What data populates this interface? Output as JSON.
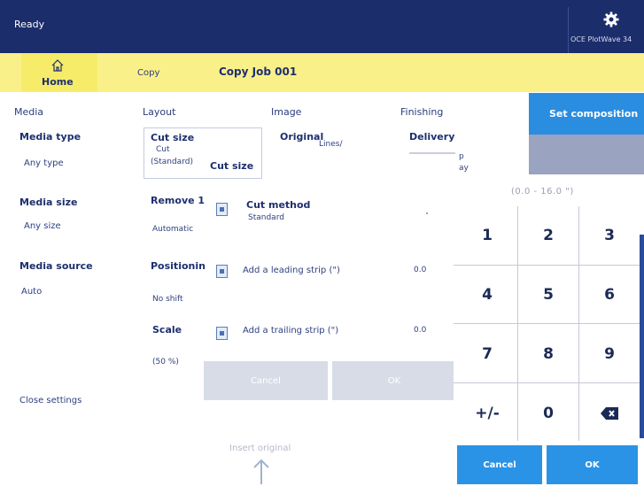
{
  "topbar": {
    "status": "Ready",
    "printer_name": "OCE PlotWave 34",
    "gear_icon": "gear-icon"
  },
  "nav": {
    "home": "Home",
    "copy": "Copy",
    "job": "Copy Job 001",
    "home_icon": "home-icon"
  },
  "media": {
    "header": "Media",
    "type_label": "Media type",
    "type_value": "Any type",
    "size_label": "Media size",
    "size_value": "Any size",
    "source_label": "Media source",
    "source_value": "Auto",
    "close": "Close settings"
  },
  "layout": {
    "header": "Layout",
    "cut_size_label": "Cut size",
    "cut_size_line1": "Cut",
    "cut_size_line2": "(Standard)",
    "cut_size_popup": "Cut size",
    "remove_label": "Remove 1",
    "remove_value": "Automatic",
    "positioning_label": "Positionin",
    "positioning_value": "No shift",
    "scale_label": "Scale",
    "scale_value": "(50 %)"
  },
  "image": {
    "header": "Image",
    "original_label": "Original",
    "original_value": "Lines/"
  },
  "finishing": {
    "header": "Finishing",
    "delivery_label": "Delivery",
    "delivery_fragment1": "p",
    "delivery_fragment2": "ay"
  },
  "cut_options": {
    "method_label": "Cut method",
    "method_value": "Standard",
    "leading_label": "Add a leading strip (\")",
    "leading_value": "0.0",
    "trailing_label": "Add a trailing strip (\")",
    "trailing_value": "0.0",
    "cancel": "Cancel",
    "ok": "OK"
  },
  "setcomp": {
    "label": "Set composition"
  },
  "keypad": {
    "range": "(0.0 - 16.0 \")",
    "keys": [
      "1",
      "2",
      "3",
      "4",
      "5",
      "6",
      "7",
      "8",
      "9",
      "+/-",
      "0"
    ],
    "backspace_icon": "backspace-icon",
    "cancel": "Cancel",
    "ok": "OK"
  },
  "footer": {
    "insert": "Insert original",
    "arrow_icon": "arrow-up-icon"
  }
}
